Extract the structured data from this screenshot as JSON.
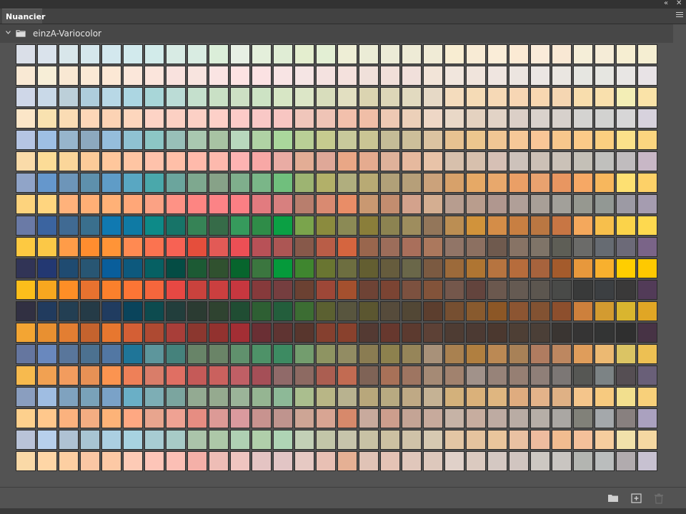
{
  "panel": {
    "title": "Nuancier"
  },
  "group": {
    "name": "einzA-Variocolor"
  },
  "icons": {
    "collapse": "double-chevron-left-icon",
    "close": "close-icon",
    "menu": "hamburger-menu-icon",
    "expand": "chevron-down-icon",
    "group": "folder-icon",
    "new_group": "new-folder-icon",
    "new_swatch": "new-swatch-icon",
    "delete": "trash-icon"
  },
  "swatches": {
    "columns": 30,
    "rows": [
      [
        "#dadfe8",
        "#dae3ec",
        "#d8e6ea",
        "#d5e7ec",
        "#d3e8ee",
        "#d2eaed",
        "#d2ebea",
        "#d8ebe4",
        "#d9ece2",
        "#dbeed9",
        "#e7efe4",
        "#e4efdb",
        "#e0edd5",
        "#e4eecf",
        "#e3efd4",
        "#eeeed6",
        "#ebecd6",
        "#ecebd6",
        "#eeebd6",
        "#f0ebd6",
        "#f8edd2",
        "#f8ebd5",
        "#faedd8",
        "#fbead4",
        "#faebd9",
        "#f9e8d4",
        "#f5eed8",
        "#f5ecd7",
        "#f6eed2",
        "#f5eed2"
      ],
      [
        "#f9e9d4",
        "#f7eed7",
        "#f9e8d3",
        "#fbe9d5",
        "#fce8d5",
        "#fbe7da",
        "#fbe5dc",
        "#f9e2de",
        "#f8e4df",
        "#fae4e3",
        "#fde3e3",
        "#fbe2e3",
        "#f8e4e4",
        "#f5e5e4",
        "#f4e2e0",
        "#f4e1dd",
        "#f0e0da",
        "#f1dfd9",
        "#f1e0db",
        "#f2e4d8",
        "#f1e6dd",
        "#f0e4dc",
        "#efe5e0",
        "#ece5e0",
        "#ebe6e3",
        "#eae6e1",
        "#e6e6e1",
        "#e6e6e1",
        "#e8e6e4",
        "#e8e3e6"
      ],
      [
        "#cfd7e8",
        "#c9d9e8",
        "#bccfd9",
        "#aecddc",
        "#b8d8e6",
        "#acd6e2",
        "#a8d6d8",
        "#bbdcd6",
        "#c5e0cd",
        "#c9e0c5",
        "#cde0c4",
        "#cde3c4",
        "#d7e6c5",
        "#dce6c7",
        "#d8ddbc",
        "#e2dfc1",
        "#dbd4b1",
        "#ddd6b8",
        "#e2dac0",
        "#e6d9c6",
        "#f4dcbd",
        "#f5dbb6",
        "#f6d9b6",
        "#f7d6b4",
        "#f8d7b1",
        "#f5d6b2",
        "#f8ddad",
        "#f9e0ad",
        "#f3eeb6",
        "#fae3a8"
      ],
      [
        "#fbe6c8",
        "#f9e2b0",
        "#fadcb4",
        "#fdd7b8",
        "#fcd3b4",
        "#fdd6bd",
        "#fdd3c5",
        "#fcd0c3",
        "#fcd0c5",
        "#fdd0c8",
        "#fccbc8",
        "#f9c8c6",
        "#f8c6c2",
        "#f0c6bb",
        "#efc4b6",
        "#f2c0ac",
        "#f0bea7",
        "#eec9b4",
        "#ecd0b9",
        "#eed7c6",
        "#e9d8c7",
        "#e4d2c0",
        "#e2d3c6",
        "#dbcfc7",
        "#d9d2cc",
        "#d7d1cc",
        "#d4d3d1",
        "#d2d2d0",
        "#d7d6d7",
        "#d7d2dd"
      ],
      [
        "#b5c5e3",
        "#9ebfe4",
        "#97b5cc",
        "#8ca9bf",
        "#95bddb",
        "#8fc2d2",
        "#8cc6c5",
        "#98c0b8",
        "#a9c8b0",
        "#a8c3a3",
        "#b8d8bd",
        "#b0d2a4",
        "#aad79c",
        "#b9cf96",
        "#c6cb8f",
        "#c8c99b",
        "#cac594",
        "#c5bc97",
        "#cdbf9a",
        "#dbc3a1",
        "#e7c291",
        "#ecc68e",
        "#f0c694",
        "#f6c898",
        "#f9c697",
        "#f7c78c",
        "#fbca88",
        "#fbcf80",
        "#fbe18a",
        "#fbd57f"
      ],
      [
        "#fadba9",
        "#fcdc97",
        "#fbd69a",
        "#fccb99",
        "#ffc79c",
        "#fec5a3",
        "#fec2ab",
        "#ffbfa8",
        "#ffbaab",
        "#fdb9ad",
        "#fdb3b2",
        "#f8a8a6",
        "#e9aca4",
        "#e3ad95",
        "#dfa898",
        "#e9a786",
        "#e5ab8f",
        "#dfb29a",
        "#e6b99e",
        "#e8c3a8",
        "#d7c0ac",
        "#d7c0ad",
        "#d6c0b5",
        "#cdc2bb",
        "#ccc0b6",
        "#cbc2b8",
        "#c4c0b7",
        "#c0c0bd",
        "#c0bcbe",
        "#c8b7c6"
      ],
      [
        "#90a4c8",
        "#6597cc",
        "#6d95b9",
        "#5e90ac",
        "#5f9cc7",
        "#59a7c2",
        "#4aa8ab",
        "#6ba59d",
        "#7ea88f",
        "#87a288",
        "#7fae8c",
        "#7ab688",
        "#70bf7d",
        "#9db472",
        "#b2b069",
        "#b0ae7e",
        "#b8aa74",
        "#b1a078",
        "#b69f79",
        "#cba27b",
        "#d7a16a",
        "#e6a966",
        "#e8a86c",
        "#ea9f66",
        "#e9a26f",
        "#e89661",
        "#f6a865",
        "#f7b75d",
        "#fde072",
        "#fdd168"
      ],
      [
        "#fdd37d",
        "#ffd57f",
        "#ffb27b",
        "#ffaf75",
        "#ffb177",
        "#ffa778",
        "#fba284",
        "#fe9285",
        "#fd8582",
        "#fc8386",
        "#fb7f84",
        "#e27b7f",
        "#d7807f",
        "#b87e6d",
        "#d98a71",
        "#e98d67",
        "#c99871",
        "#c38d6f",
        "#d3a28c",
        "#d4ae91",
        "#b79d8f",
        "#b99d8d",
        "#b0978f",
        "#b09f98",
        "#a89f97",
        "#a2a09a",
        "#969890",
        "#929894",
        "#9c9aa4",
        "#a59cb0"
      ],
      [
        "#6a7aa6",
        "#3b64a0",
        "#406a93",
        "#3a6f8d",
        "#1079b1",
        "#0f7aa4",
        "#0d8a88",
        "#177468",
        "#368356",
        "#366b48",
        "#369a5c",
        "#2f8c48",
        "#0ba044",
        "#7aa44c",
        "#8b8b3e",
        "#8b8a55",
        "#8a7e3a",
        "#8c8351",
        "#9e8d5e",
        "#93765a",
        "#bb8e53",
        "#d1933b",
        "#d48d48",
        "#c87f42",
        "#ba7742",
        "#c87644",
        "#f4a85c",
        "#f7bf4c",
        "#fbd34a",
        "#fed94f"
      ],
      [
        "#fdc941",
        "#fbc847",
        "#ff9c48",
        "#ff8d2f",
        "#ff9437",
        "#ff8a52",
        "#fb7350",
        "#f76254",
        "#e54e3c",
        "#e25a56",
        "#ec4f55",
        "#b85157",
        "#ac5654",
        "#87594a",
        "#b95d47",
        "#d5653f",
        "#99664d",
        "#9c6d5a",
        "#a96f5b",
        "#ab785d",
        "#917567",
        "#8c7061",
        "#6f5a4e",
        "#877365",
        "#7f7468",
        "#5e5e56",
        "#6b6b69",
        "#666b72",
        "#6c6a78",
        "#7a6488"
      ],
      [
        "#313456",
        "#233872",
        "#1f4b71",
        "#285673",
        "#095e9b",
        "#0d597d",
        "#066063",
        "#044c44",
        "#1c5a34",
        "#30512f",
        "#07652d",
        "#3b763f",
        "#059a3b",
        "#3f862f",
        "#697531",
        "#6d6e40",
        "#635e31",
        "#665c3d",
        "#6a6749",
        "#7b5a41",
        "#9c6a3a",
        "#af7532",
        "#b67440",
        "#b66c3c",
        "#a7633d",
        "#a45b2c",
        "#e7983c",
        "#f8b02e",
        "#ffce00",
        "#fec900"
      ],
      [
        "#fcbe1b",
        "#f8a71f",
        "#fe8e26",
        "#e8722f",
        "#fb802c",
        "#fc7535",
        "#f5663c",
        "#e74843",
        "#c9423d",
        "#cb3f3f",
        "#c7373f",
        "#863a3b",
        "#753e3f",
        "#6b4132",
        "#9d4737",
        "#a4502e",
        "#6e4335",
        "#7b4433",
        "#7c513f",
        "#82533a",
        "#74574b",
        "#63443d",
        "#6b584e",
        "#655a52",
        "#5c564f",
        "#494a48",
        "#393a3a",
        "#3c3f42",
        "#3a3939",
        "#523b58"
      ],
      [
        "#313042",
        "#213b5e",
        "#233f53",
        "#253b47",
        "#203c60",
        "#0a445b",
        "#0d4b4f",
        "#223e3c",
        "#2b3b32",
        "#2f4330",
        "#204d33",
        "#2e5f33",
        "#235e3c",
        "#3c6d33",
        "#5b6031",
        "#58553e",
        "#5b5630",
        "#564b3b",
        "#524735",
        "#5c3e2e",
        "#764f31",
        "#885a2e",
        "#8c5726",
        "#8c5532",
        "#825232",
        "#8d4f2d",
        "#cd803c",
        "#d39b30",
        "#d9b52f",
        "#e0a625"
      ],
      [
        "#f3a533",
        "#e89031",
        "#e37e32",
        "#c5632e",
        "#e7772f",
        "#d45f35",
        "#ae4a32",
        "#a83e39",
        "#8b372f",
        "#92322f",
        "#a32e34",
        "#6a2f34",
        "#5f3432",
        "#58362d",
        "#85402f",
        "#89412d",
        "#543a33",
        "#67382e",
        "#5c3a2f",
        "#5d4136",
        "#4e3c33",
        "#4c3a33",
        "#4b382f",
        "#4e3f35",
        "#4b3f37",
        "#3a3532",
        "#353434",
        "#333434",
        "#2f2f2f",
        "#473345"
      ],
      [
        "#65769f",
        "#6988be",
        "#59769b",
        "#4c7190",
        "#5277a3",
        "#1f7598",
        "#5d969c",
        "#45827c",
        "#688468",
        "#6a8467",
        "#60916d",
        "#4e9268",
        "#3d8b62",
        "#739d6e",
        "#8e9462",
        "#928c63",
        "#8a7c52",
        "#8d814e",
        "#968559",
        "#a89179",
        "#a98150",
        "#b07f40",
        "#bb8954",
        "#a88157",
        "#b07c60",
        "#bd8760",
        "#df9d5b",
        "#ecb972",
        "#dbc464",
        "#edc053"
      ],
      [
        "#f7ba4e",
        "#f1a152",
        "#f29c5e",
        "#e79155",
        "#fb9450",
        "#ee8058",
        "#d97d69",
        "#e06f63",
        "#c55a58",
        "#ca615e",
        "#c05f65",
        "#a54f57",
        "#906a69",
        "#8d6a62",
        "#ab5e51",
        "#c26b52",
        "#7f6356",
        "#a87158",
        "#9e7561",
        "#a58a75",
        "#a1826e",
        "#a1928a",
        "#978379",
        "#967f73",
        "#8f7f78",
        "#7c7775",
        "#565754",
        "#7c8385",
        "#554e53",
        "#695f78"
      ],
      [
        "#8a9ebf",
        "#9fbde2",
        "#7fa2bf",
        "#79a2b9",
        "#7aa2c8",
        "#6aafc6",
        "#7daeb5",
        "#7ba59f",
        "#93aa92",
        "#95aa8f",
        "#9bb499",
        "#95b592",
        "#8db997",
        "#aabe8e",
        "#b8b686",
        "#b8b28f",
        "#b8a77b",
        "#b8aa81",
        "#bfa985",
        "#c5b294",
        "#d3b17b",
        "#dab17a",
        "#dfb680",
        "#dfac7f",
        "#e3b38a",
        "#dfb185",
        "#f4c58b",
        "#f7ca7f",
        "#f2df8e",
        "#f8d07a"
      ],
      [
        "#fdd08d",
        "#ffc88c",
        "#fbb27e",
        "#f3ad82",
        "#fdb378",
        "#fea882",
        "#e8a58e",
        "#efa293",
        "#e68d82",
        "#dc9a96",
        "#da9a9e",
        "#c8938f",
        "#bf948e",
        "#cda595",
        "#d8a593",
        "#d7896b",
        "#c8aa9d",
        "#cd9e8d",
        "#c4a495",
        "#c7aa9c",
        "#c6b3a6",
        "#c7ad9f",
        "#beaba2",
        "#b9aca4",
        "#b6aea7",
        "#aaa7a3",
        "#818179",
        "#a4a8ab",
        "#88807f",
        "#aaa1bf"
      ],
      [
        "#b9c3d8",
        "#b7d0ec",
        "#afc2d3",
        "#a8c5d3",
        "#abcfe1",
        "#a7d2e0",
        "#a7ccd2",
        "#a7cbc7",
        "#abc4aa",
        "#adc8a8",
        "#afd0b3",
        "#b0cfaa",
        "#afd4b5",
        "#c2d0b6",
        "#c2c6a8",
        "#c7c4ab",
        "#c8c2a5",
        "#ccc1a2",
        "#cfc2a8",
        "#d6c9b1",
        "#e3c6a4",
        "#e5c39e",
        "#e9c59c",
        "#e9c1a2",
        "#eebc9f",
        "#f1bc90",
        "#f4c09a",
        "#f6cd9e",
        "#f1e1aa",
        "#f5d8a2"
      ],
      [
        "#fad9a7",
        "#fed6a6",
        "#fdcfa2",
        "#fac7a4",
        "#fdc9a5",
        "#fdcbb6",
        "#fdc5b8",
        "#fbbfb5",
        "#f4b0a8",
        "#eebdb6",
        "#efc5c0",
        "#e4c4c3",
        "#e2c5c5",
        "#e6c9c3",
        "#e8c0b4",
        "#e5b094",
        "#e0c3b6",
        "#e5c3b5",
        "#e0c7bb",
        "#ddc8bc",
        "#e0d1c9",
        "#dbcac0",
        "#d4c8c2",
        "#d1c5c0",
        "#cdc8c2",
        "#c9c5c1",
        "#b3b5b1",
        "#babdbd",
        "#b1abae",
        "#c7c1d1"
      ]
    ]
  }
}
